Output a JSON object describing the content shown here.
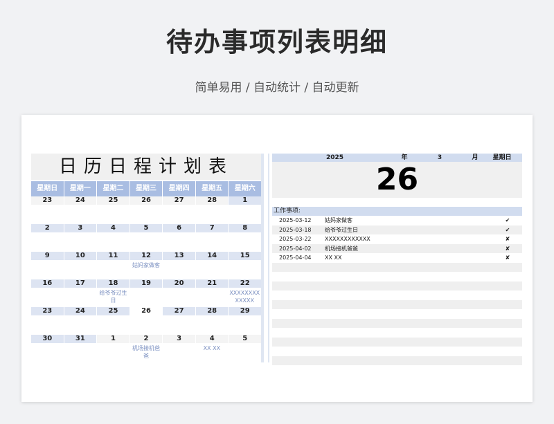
{
  "header": {
    "title": "待办事项列表明细",
    "subtitle": "简单易用 / 自动统计 / 自动更新"
  },
  "calendar": {
    "title": "日历日程计划表",
    "weekdays": [
      "星期日",
      "星期一",
      "星期二",
      "星期三",
      "星期四",
      "星期五",
      "星期六"
    ],
    "weeks": [
      {
        "dates": [
          "23",
          "24",
          "25",
          "26",
          "27",
          "28",
          "1"
        ],
        "events": [
          "",
          "",
          "",
          "",
          "",
          "",
          ""
        ]
      },
      {
        "dates": [
          "2",
          "3",
          "4",
          "5",
          "6",
          "7",
          "8"
        ],
        "events": [
          "",
          "",
          "",
          "",
          "",
          "",
          ""
        ]
      },
      {
        "dates": [
          "9",
          "10",
          "11",
          "12",
          "13",
          "14",
          "15"
        ],
        "events": [
          "",
          "",
          "",
          "姑妈家做客",
          "",
          "",
          ""
        ]
      },
      {
        "dates": [
          "16",
          "17",
          "18",
          "19",
          "20",
          "21",
          "22"
        ],
        "events": [
          "",
          "",
          "给爷爷过生日",
          "",
          "",
          "",
          "XXXXXXXXXXXXX"
        ]
      },
      {
        "dates": [
          "23",
          "24",
          "25",
          "26",
          "27",
          "28",
          "29"
        ],
        "events": [
          "",
          "",
          "",
          "",
          "",
          "",
          ""
        ]
      },
      {
        "dates": [
          "30",
          "31",
          "1",
          "2",
          "3",
          "4",
          "5"
        ],
        "events": [
          "",
          "",
          "",
          "机场接机爸爸",
          "",
          "XX XX",
          ""
        ]
      }
    ]
  },
  "date_header": {
    "year": "2025",
    "year_label": "年",
    "month": "3",
    "month_label": "月",
    "weekday_label": "星期日",
    "day": "26"
  },
  "tasks": {
    "header": "工作事项:",
    "items": [
      {
        "date": "2025-03-12",
        "name": "姑妈家做客",
        "status": "✔"
      },
      {
        "date": "2025-03-18",
        "name": "给爷爷过生日",
        "status": "✔"
      },
      {
        "date": "2025-03-22",
        "name": "XXXXXXXXXXXX",
        "status": "✘"
      },
      {
        "date": "2025-04-02",
        "name": "机场接机爸爸",
        "status": "✘"
      },
      {
        "date": "2025-04-04",
        "name": "XX XX",
        "status": "✘"
      }
    ]
  }
}
